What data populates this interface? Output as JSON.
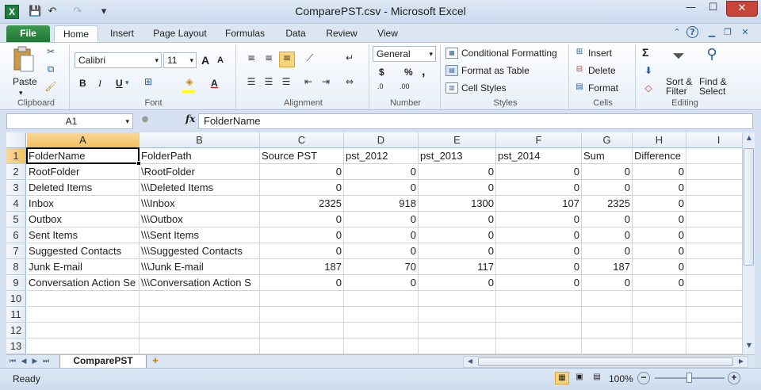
{
  "window": {
    "title": "ComparePST.csv - Microsoft Excel",
    "app_icon": "X",
    "qat": {
      "save_icon": "💾",
      "undo_icon": "↶",
      "redo_icon": "↷",
      "customize_icon": "▾"
    },
    "controls": {
      "minimize": "—",
      "maximize": "☐",
      "close": "✕"
    }
  },
  "ribbon_tabs": [
    "File",
    "Home",
    "Insert",
    "Page Layout",
    "Formulas",
    "Data",
    "Review",
    "View"
  ],
  "ribbon": {
    "clipboard": {
      "label": "Clipboard",
      "paste": "Paste"
    },
    "font": {
      "label": "Font",
      "name": "Calibri",
      "size": "11",
      "bold": "B",
      "italic": "I",
      "underline": "U",
      "grow": "A",
      "shrink": "A"
    },
    "alignment": {
      "label": "Alignment"
    },
    "number": {
      "label": "Number",
      "format": "General",
      "currency": "$",
      "percent": "%",
      "comma": ",",
      "inc_dec": ".0",
      "dec_dec": ".00"
    },
    "styles": {
      "label": "Styles",
      "conditional": "Conditional Formatting",
      "format_table": "Format as Table",
      "cell_styles": "Cell Styles"
    },
    "cells": {
      "label": "Cells",
      "insert": "Insert",
      "delete": "Delete",
      "format": "Format"
    },
    "editing": {
      "label": "Editing",
      "sum": "Σ",
      "sort": "Sort &",
      "filter": "Filter",
      "find": "Find &",
      "select": "Select"
    }
  },
  "formula_bar": {
    "name_box": "A1",
    "fx": "fx",
    "content": "FolderName"
  },
  "grid": {
    "columns": [
      "A",
      "B",
      "C",
      "D",
      "E",
      "F",
      "G",
      "H",
      "I"
    ],
    "rows": [
      [
        "FolderName",
        "FolderPath",
        "Source PST",
        "pst_2012",
        "pst_2013",
        "pst_2014",
        "Sum",
        "Difference",
        ""
      ],
      [
        "RootFolder",
        "\\RootFolder",
        "0",
        "0",
        "0",
        "0",
        "0",
        "0",
        ""
      ],
      [
        "Deleted Items",
        "\\\\\\Deleted Items",
        "0",
        "0",
        "0",
        "0",
        "0",
        "0",
        ""
      ],
      [
        "Inbox",
        "\\\\\\Inbox",
        "2325",
        "918",
        "1300",
        "107",
        "2325",
        "0",
        ""
      ],
      [
        "Outbox",
        "\\\\\\Outbox",
        "0",
        "0",
        "0",
        "0",
        "0",
        "0",
        ""
      ],
      [
        "Sent Items",
        "\\\\\\Sent Items",
        "0",
        "0",
        "0",
        "0",
        "0",
        "0",
        ""
      ],
      [
        "Suggested Contacts",
        "\\\\\\Suggested Contacts",
        "0",
        "0",
        "0",
        "0",
        "0",
        "0",
        ""
      ],
      [
        "Junk E-mail",
        "\\\\\\Junk E-mail",
        "187",
        "70",
        "117",
        "0",
        "187",
        "0",
        ""
      ],
      [
        "Conversation Action Se",
        "\\\\\\Conversation Action S",
        "0",
        "0",
        "0",
        "0",
        "0",
        "0",
        ""
      ],
      [
        "",
        "",
        "",
        "",
        "",
        "",
        "",
        "",
        ""
      ],
      [
        "",
        "",
        "",
        "",
        "",
        "",
        "",
        "",
        ""
      ],
      [
        "",
        "",
        "",
        "",
        "",
        "",
        "",
        "",
        ""
      ],
      [
        "",
        "",
        "",
        "",
        "",
        "",
        "",
        "",
        ""
      ]
    ]
  },
  "sheet_tabs": [
    "ComparePST"
  ],
  "status": {
    "ready": "Ready",
    "zoom": "100%"
  }
}
